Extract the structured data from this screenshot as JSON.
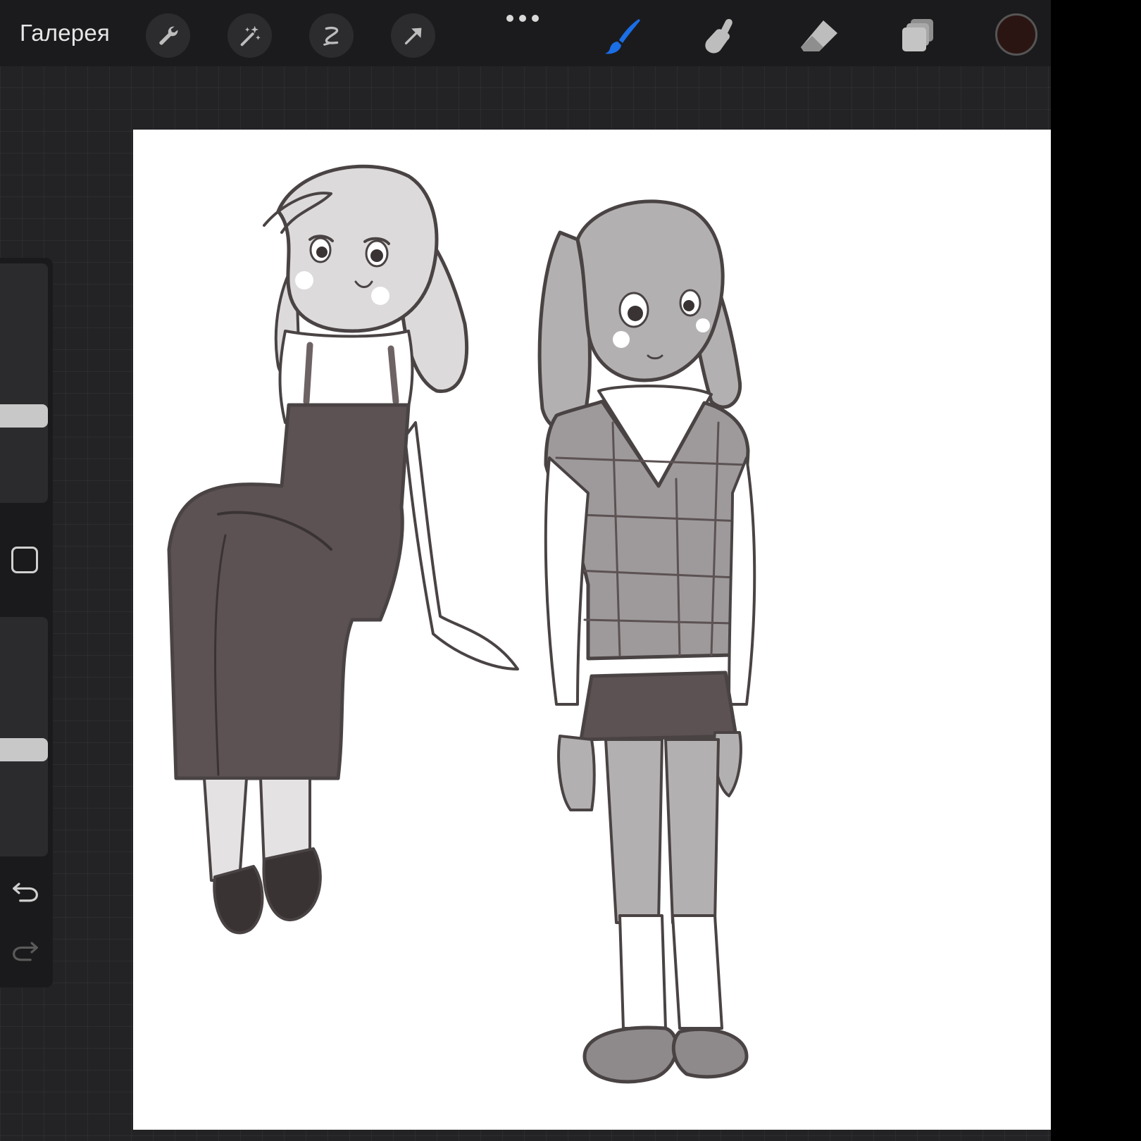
{
  "toolbar": {
    "gallery_label": "Галерея",
    "left_tools": [
      {
        "name": "actions-wrench-icon"
      },
      {
        "name": "adjustments-wand-icon"
      },
      {
        "name": "selection-icon"
      },
      {
        "name": "transform-arrow-icon"
      }
    ],
    "right_tools": [
      {
        "name": "brush-icon",
        "active": true
      },
      {
        "name": "smudge-icon"
      },
      {
        "name": "eraser-icon"
      },
      {
        "name": "layers-icon"
      }
    ],
    "active_color": "#2b1512",
    "accent_color": "#1a6ee6"
  },
  "sidebar": {
    "size_slider_level": 0.65,
    "opacity_slider_level": 0.5,
    "modify_button": "square-icon",
    "undo": "undo-icon",
    "redo": "redo-icon"
  },
  "canvas": {
    "background": "#ffffff",
    "content": "sketch-of-two-characters"
  }
}
